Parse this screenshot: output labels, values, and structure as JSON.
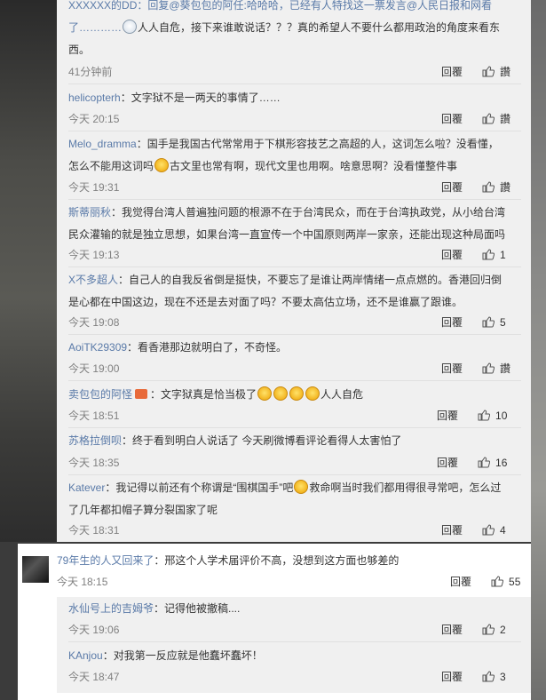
{
  "ui": {
    "reply": "回覆",
    "like": "讚"
  },
  "comments": [
    {
      "line1": "XXXXXX的DD：回复@葵包包的阿任:哈哈哈，已经有人特找这一票发言@人民日报和网看",
      "line2_pre": "了…………",
      "line2_post": "人人自危，接下来谁敢说话？？？真的希望人不要什么都用政治的角度来看东",
      "line3": "西。",
      "time": "41分钟前",
      "likes": "讚"
    },
    {
      "user": "helicopterh",
      "text": "：文字狱不是一两天的事情了……",
      "time": "今天 20:15",
      "likes": "讚"
    },
    {
      "user": "Melo_dramma",
      "line1": "：国手是我国古代常常用于下棋形容技艺之高超的人，这词怎么啦？没看懂，",
      "line2_pre": "怎么不能用这词吗",
      "line2_post": "古文里也常有啊，现代文里也用啊。啥意思啊？没看懂整件事",
      "time": "今天 19:31",
      "likes": "讚"
    },
    {
      "user": "斯蒂丽秋",
      "line1": "：我觉得台湾人普遍独问题的根源不在于台湾民众，而在于台湾执政党，从小给台湾",
      "line2": "民众灌输的就是独立思想，如果台湾一直宣传一个中国原则两岸一家亲，还能出现这种局面吗",
      "time": "今天 19:13",
      "likes": "1"
    },
    {
      "user": "X不多超人",
      "line1": "：自己人的自我反省倒是挺快，不要忘了是谁让两岸情绪一点点燃的。香港回归倒",
      "line2": "是心都在中国这边，现在不还是去对面了吗？不要太高估立场，还不是谁赢了跟谁。",
      "time": "今天 19:08",
      "likes": "5"
    },
    {
      "user": "AoiTK29309",
      "text": "：看香港那边就明白了，不奇怪。",
      "time": "今天 19:00",
      "likes": "讚"
    },
    {
      "user": "卖包包的阿怪",
      "text_pre": "：文字狱真是恰当极了",
      "text_post": "人人自危",
      "time": "今天 18:51",
      "likes": "10"
    },
    {
      "user": "苏格拉倒呗",
      "text": "：终于看到明白人说话了 今天刷微博看评论看得人太害怕了",
      "time": "今天 18:35",
      "likes": "16"
    },
    {
      "user": "Katever",
      "line1_pre": "：我记得以前还有个称谓是“围棋国手”吧",
      "line1_post": "救命啊当时我们都用得很寻常吧，怎么过",
      "line2": "了几年都扣帽子算分裂国家了呢",
      "time": "今天 18:31",
      "likes": "4"
    }
  ],
  "main_comment": {
    "user": "79年生的人又回来了",
    "text": "：邢这个人学术届评价不高，没想到这方面也够差的",
    "time": "今天 18:15",
    "likes": "55"
  },
  "replies": [
    {
      "user": "水仙号上的吉姆爷",
      "text": "：记得他被撤稿....",
      "time": "今天 19:06",
      "likes": "2"
    },
    {
      "user": "KAnjou",
      "text": "：对我第一反应就是他蠢坏蠢坏！",
      "time": "今天 18:47",
      "likes": "3"
    }
  ]
}
